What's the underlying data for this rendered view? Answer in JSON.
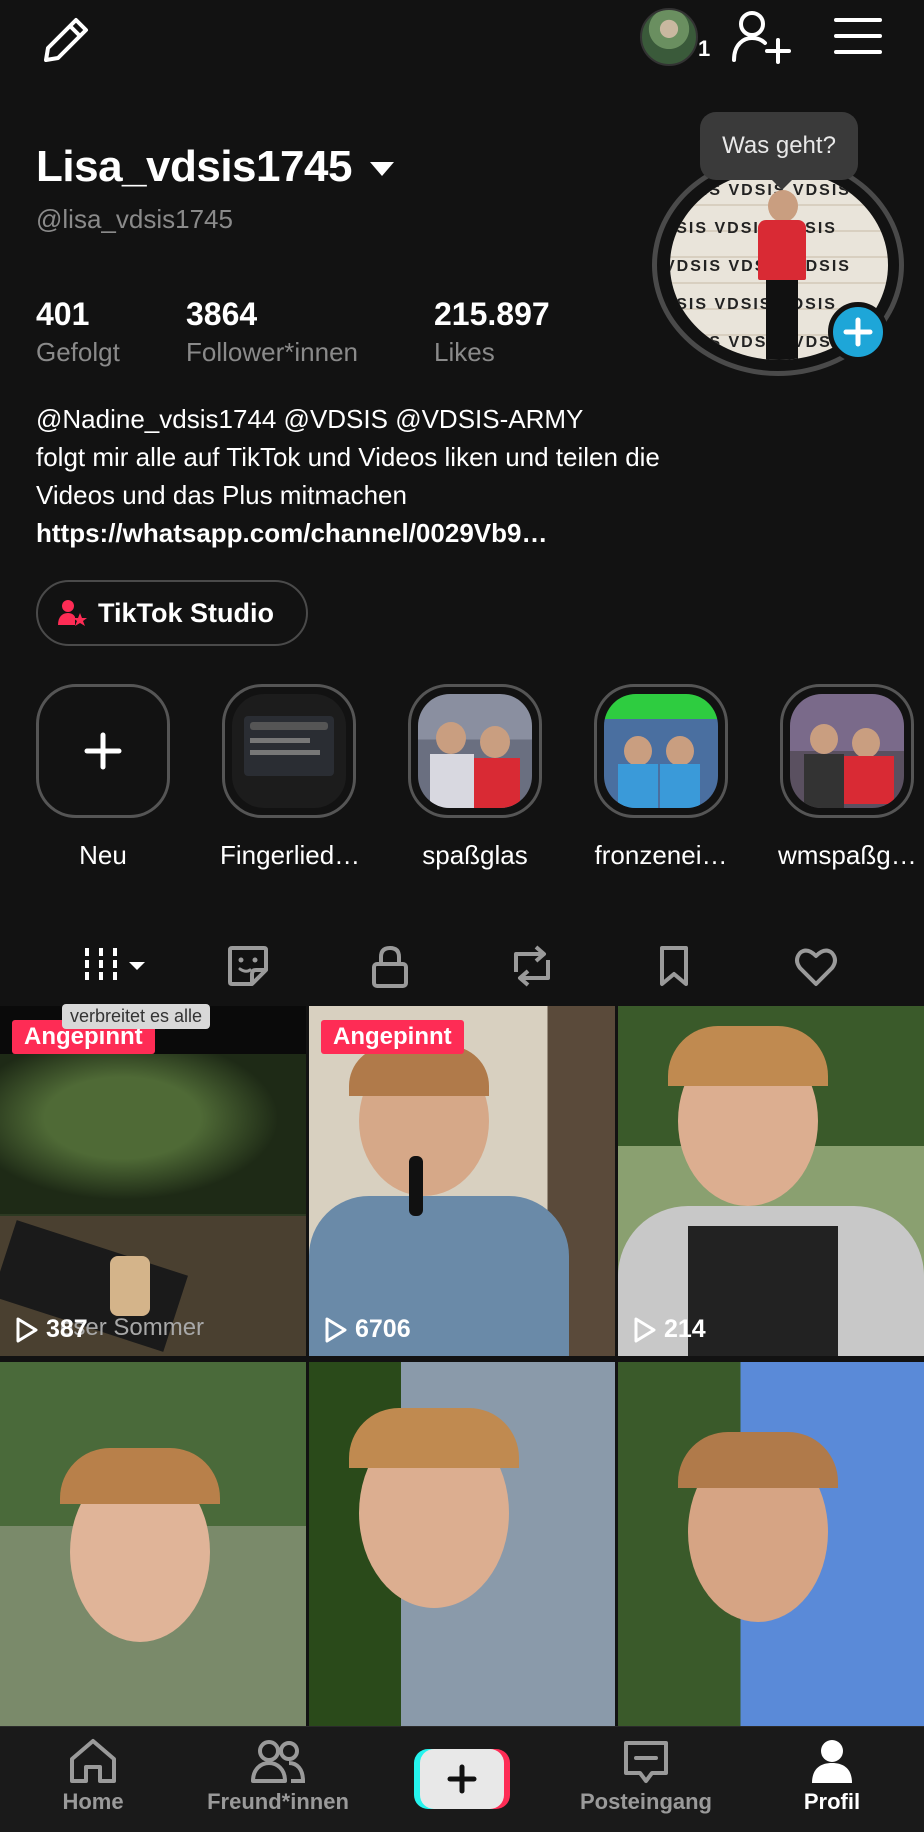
{
  "profile": {
    "username": "Lisa_vdsis1745",
    "handle": "@lisa_vdsis1745",
    "friend_notification_count": "1",
    "tooltip": "Was geht?",
    "profile_wall_text": "VDSIS VDSIS VDSIS"
  },
  "stats": [
    {
      "value": "401",
      "label": "Gefolgt"
    },
    {
      "value": "3864",
      "label": "Follower*innen"
    },
    {
      "value": "215.897",
      "label": "Likes"
    }
  ],
  "bio": {
    "mentions": "@Nadine_vdsis1744 @VDSIS @VDSIS-ARMY",
    "line1": "folgt mir alle auf TikTok und Videos liken und teilen die",
    "line2": "Videos und das Plus mitmachen",
    "link": "https://whatsapp.com/channel/0029Vb9…"
  },
  "studio_button": {
    "label": "TikTok Studio"
  },
  "highlights": [
    {
      "label": "Neu"
    },
    {
      "label": "Fingerlied…"
    },
    {
      "label": "spaßglas"
    },
    {
      "label": "fronzenei…"
    },
    {
      "label": "wmspaßg…"
    }
  ],
  "tabs": [
    "videos-grid",
    "stickers",
    "private",
    "reposts",
    "saved",
    "liked"
  ],
  "videos": [
    {
      "pinned": "Angepinnt",
      "views": "387",
      "caption": "verbreitet es alle",
      "overlay": "eser Sommer"
    },
    {
      "pinned": "Angepinnt",
      "views": "6706"
    },
    {
      "views": "214"
    },
    {},
    {},
    {}
  ],
  "bottom_nav": {
    "home": "Home",
    "friends": "Freund*innen",
    "inbox": "Posteingang",
    "profile": "Profil"
  },
  "colors": {
    "background": "#121212",
    "accent_pink": "#fe2c55",
    "accent_cyan": "#25f4ee",
    "story_blue": "#1ea6d8"
  }
}
